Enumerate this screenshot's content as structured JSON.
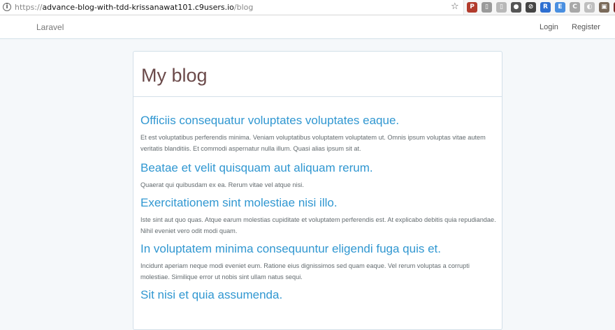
{
  "browser": {
    "url_scheme": "https://",
    "url_host": "advance-blog-with-tdd-krissanawat101.c9users.io",
    "url_path": "/blog",
    "extensions": [
      {
        "icon": "extension-red-icon",
        "color": "#b23b2c",
        "glyph": "P"
      },
      {
        "icon": "extension-gray-icon",
        "color": "#9a9a9a",
        "glyph": "▯"
      },
      {
        "icon": "extension-gray2-icon",
        "color": "#b8b8b8",
        "glyph": "▯"
      },
      {
        "icon": "extension-circle-icon",
        "color": "#555555",
        "glyph": "●"
      },
      {
        "icon": "extension-cancel-icon",
        "color": "#444444",
        "glyph": "⊘"
      },
      {
        "icon": "extension-blue-icon",
        "color": "#2e6fd1",
        "glyph": "R"
      },
      {
        "icon": "extension-blue2-icon",
        "color": "#4a8fe0",
        "glyph": "E"
      },
      {
        "icon": "extension-gray3-icon",
        "color": "#a8a8a8",
        "glyph": "C"
      },
      {
        "icon": "extension-gray4-icon",
        "color": "#bfbfbf",
        "glyph": "◐"
      },
      {
        "icon": "extension-photo-icon",
        "color": "#7a6a5a",
        "glyph": "▣"
      },
      {
        "icon": "extension-dark-icon",
        "color": "#7a2a2a",
        "glyph": "✗"
      },
      {
        "icon": "extension-puzzle-icon",
        "color": "#5a5a5a",
        "glyph": "✱"
      }
    ]
  },
  "navbar": {
    "brand": "Laravel",
    "login": "Login",
    "register": "Register"
  },
  "panel": {
    "title": "My blog"
  },
  "posts": [
    {
      "title": "Officiis consequatur voluptates voluptates eaque.",
      "body": "Et est voluptatibus perferendis minima. Veniam voluptatibus voluptatem voluptatem ut. Omnis ipsum voluptas vitae autem veritatis blanditiis. Et commodi aspernatur nulla illum. Quasi alias ipsum sit at."
    },
    {
      "title": "Beatae et velit quisquam aut aliquam rerum.",
      "body": "Quaerat qui quibusdam ex ea. Rerum vitae vel atque nisi."
    },
    {
      "title": "Exercitationem sint molestiae nisi illo.",
      "body": "Iste sint aut quo quas. Atque earum molestias cupiditate et voluptatem perferendis est. At explicabo debitis quia repudiandae. Nihil eveniet vero odit modi quam."
    },
    {
      "title": "In voluptatem minima consequuntur eligendi fuga quis et.",
      "body": "Incidunt aperiam neque modi eveniet eum. Ratione eius dignissimos sed quam eaque. Vel rerum voluptas a corrupti molestiae. Similique error ut nobis sint ullam natus sequi."
    },
    {
      "title": "Sit nisi et quia assumenda.",
      "body": ""
    }
  ],
  "colors": {
    "link": "#3097d1",
    "title": "#6b4a4a",
    "text": "#636b6f",
    "background": "#f5f8fa"
  }
}
